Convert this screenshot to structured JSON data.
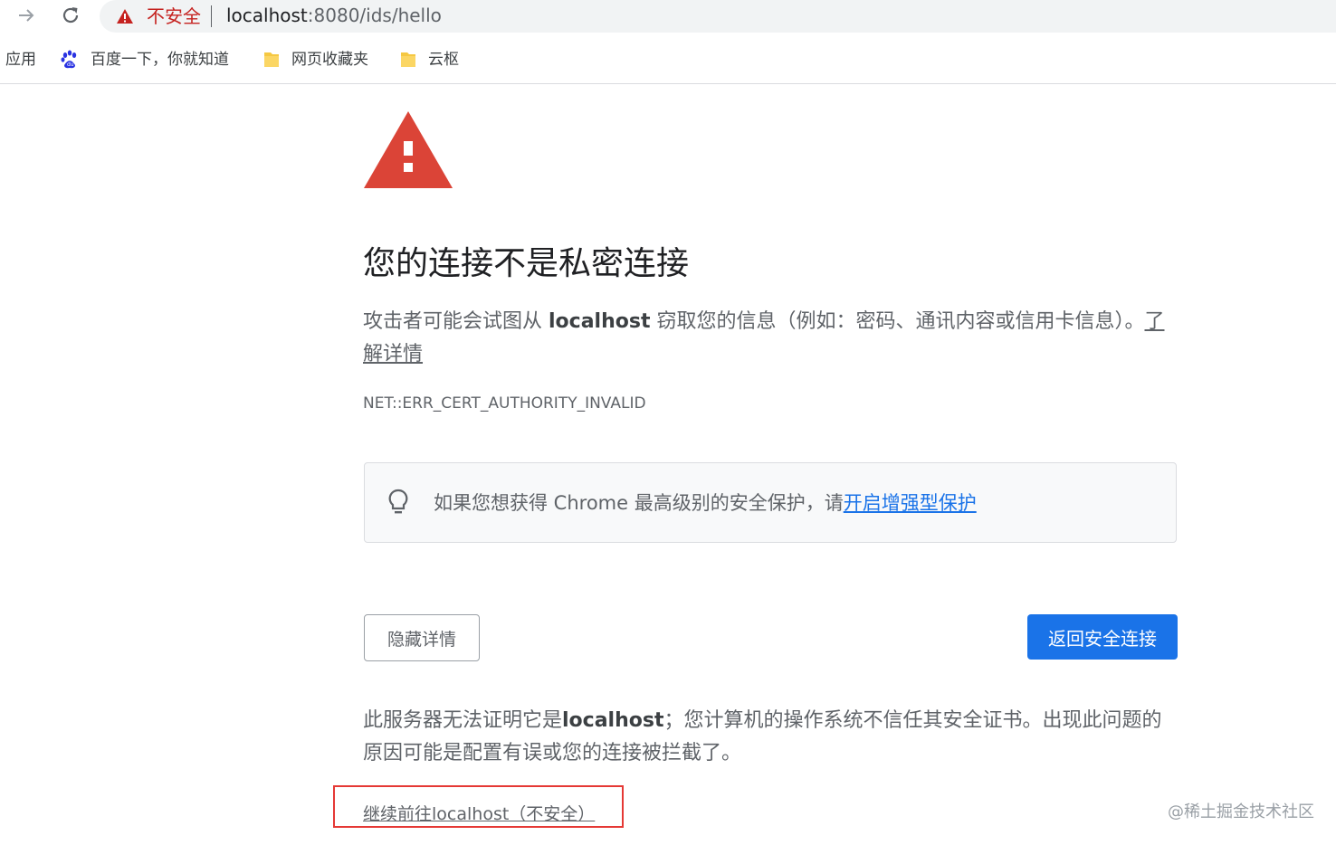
{
  "browser": {
    "security_label": "不安全",
    "url_host": "localhost",
    "url_rest": ":8080/ids/hello"
  },
  "bookmarks": {
    "apps": "应用",
    "items": [
      {
        "label": "百度一下，你就知道",
        "icon": "baidu-paw-icon"
      },
      {
        "label": "网页收藏夹",
        "icon": "folder-icon"
      },
      {
        "label": "云枢",
        "icon": "folder-icon"
      }
    ]
  },
  "interstitial": {
    "heading": "您的连接不是私密连接",
    "explanation_prefix": "攻击者可能会试图从 ",
    "explanation_host": "localhost",
    "explanation_suffix": " 窃取您的信息（例如：密码、通讯内容或信用卡信息）。",
    "learn_more": "了解详情",
    "error_code": "NET::ERR_CERT_AUTHORITY_INVALID",
    "enhanced_text": "如果您想获得 Chrome 最高级别的安全保护，请",
    "enhanced_link": "开启增强型保护",
    "hide_details": "隐藏详情",
    "back_to_safety": "返回安全连接",
    "details_prefix": "此服务器无法证明它是",
    "details_host": "localhost",
    "details_suffix": "；您计算机的操作系统不信任其安全证书。出现此问题的原因可能是配置有误或您的连接被拦截了。",
    "proceed_link": "继续前往localhost（不安全）"
  },
  "watermark": "@稀土掘金技术社区",
  "colors": {
    "warning_red": "#d93025",
    "link_blue": "#1a73e8",
    "primary_button": "#1a73e8",
    "highlight_box": "#e53935"
  }
}
